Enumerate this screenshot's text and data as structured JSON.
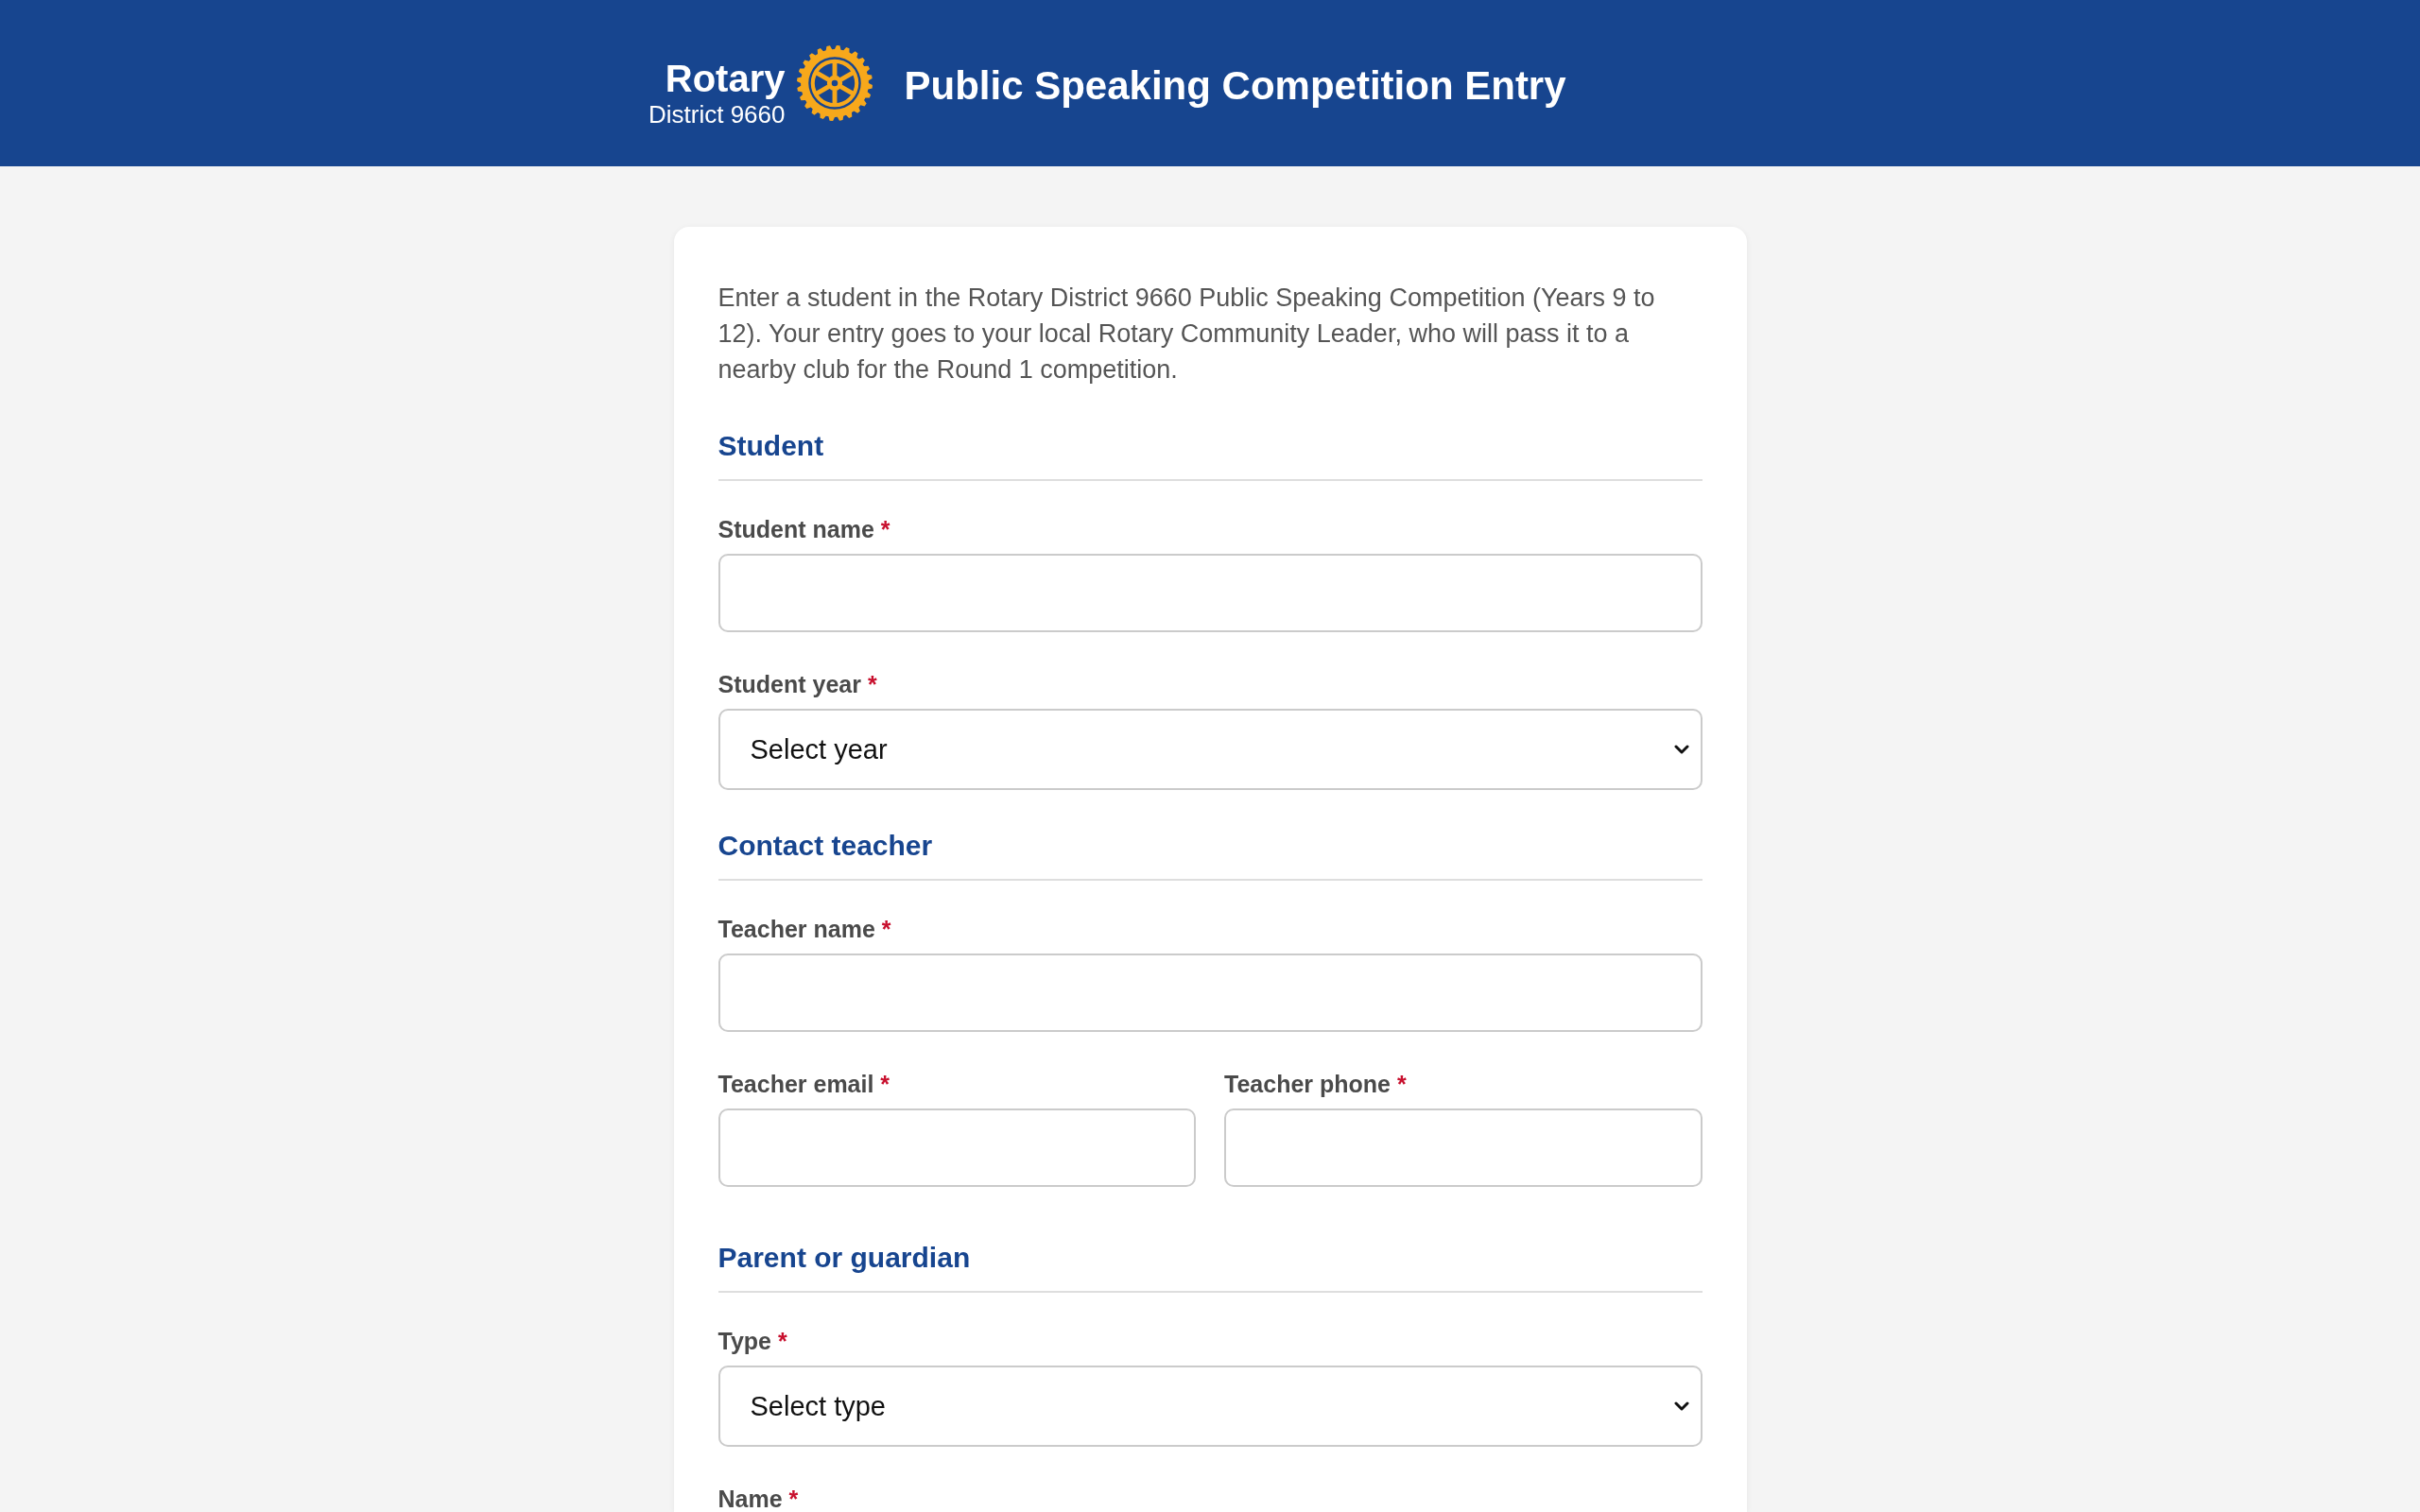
{
  "header": {
    "logo": {
      "wordmark": "Rotary",
      "subtitle": "District 9660"
    },
    "title": "Public Speaking Competition Entry"
  },
  "form": {
    "intro": "Enter a student in the Rotary District 9660 Public Speaking Competition (Years 9 to 12). Your entry goes to your local Rotary Community Leader, who will pass it to a nearby club for the Round 1 competition.",
    "sections": [
      {
        "heading": "Student",
        "rows": [
          [
            {
              "kind": "text",
              "label": "Student name",
              "required_mark": "*"
            }
          ],
          [
            {
              "kind": "select",
              "label": "Student year",
              "required_mark": "*",
              "value": "Select year"
            }
          ]
        ]
      },
      {
        "heading": "Contact teacher",
        "rows": [
          [
            {
              "kind": "text",
              "label": "Teacher name",
              "required_mark": "*"
            }
          ],
          [
            {
              "kind": "text",
              "label": "Teacher email",
              "required_mark": "*"
            },
            {
              "kind": "text",
              "label": "Teacher phone",
              "required_mark": "*"
            }
          ]
        ]
      },
      {
        "heading": "Parent or guardian",
        "rows": [
          [
            {
              "kind": "select",
              "label": "Type",
              "required_mark": "*",
              "value": "Select type"
            }
          ],
          [
            {
              "label": "Name",
              "required_mark": "*"
            }
          ]
        ]
      }
    ]
  }
}
